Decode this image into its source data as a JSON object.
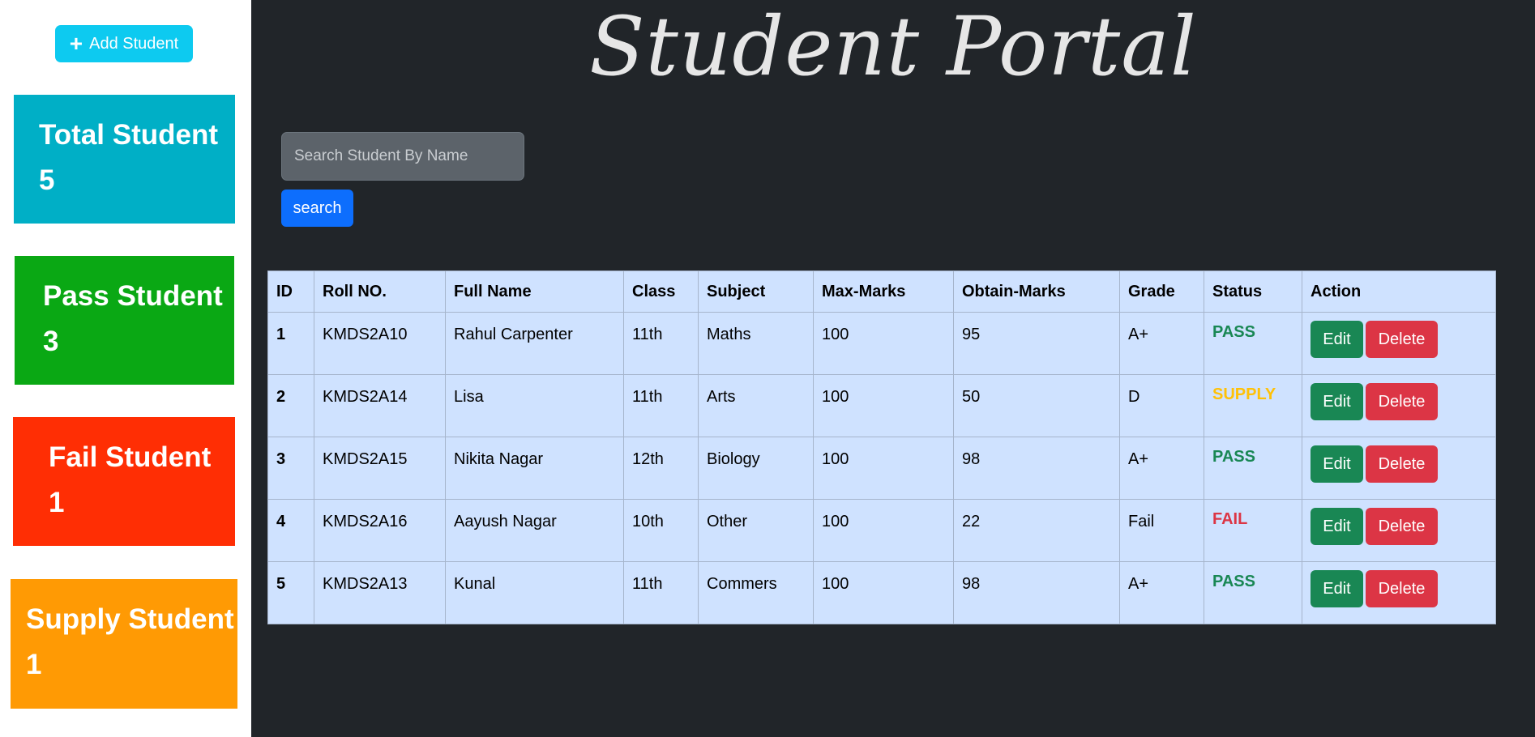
{
  "sidebar": {
    "add_button_label": "Add Student",
    "cards": {
      "total": {
        "label": "Total Student",
        "count": "5",
        "color": "#00afc6"
      },
      "pass": {
        "label": "Pass Student",
        "count": "3",
        "color": "#0aa814"
      },
      "fail": {
        "label": "Fail Student",
        "count": "1",
        "color": "#ff2e04"
      },
      "supply": {
        "label": "Supply Student",
        "count": "1",
        "color": "#ff9a04"
      }
    }
  },
  "main": {
    "title": "Student Portal",
    "search": {
      "placeholder": "Search Student By Name",
      "value": "",
      "button_label": "search"
    },
    "table": {
      "headers": [
        "ID",
        "Roll NO.",
        "Full Name",
        "Class",
        "Subject",
        "Max-Marks",
        "Obtain-Marks",
        "Grade",
        "Status",
        "Action"
      ],
      "edit_label": "Edit",
      "delete_label": "Delete",
      "rows": [
        {
          "id": "1",
          "roll": "KMDS2A10",
          "name": "Rahul Carpenter",
          "class": "11th",
          "subject": "Maths",
          "max": "100",
          "obtain": "95",
          "grade": "A+",
          "status": "PASS",
          "status_color": "#198754"
        },
        {
          "id": "2",
          "roll": "KMDS2A14",
          "name": "Lisa",
          "class": "11th",
          "subject": "Arts",
          "max": "100",
          "obtain": "50",
          "grade": "D",
          "status": "SUPPLY",
          "status_color": "#ffc107"
        },
        {
          "id": "3",
          "roll": "KMDS2A15",
          "name": "Nikita Nagar",
          "class": "12th",
          "subject": "Biology",
          "max": "100",
          "obtain": "98",
          "grade": "A+",
          "status": "PASS",
          "status_color": "#198754"
        },
        {
          "id": "4",
          "roll": "KMDS2A16",
          "name": "Aayush Nagar",
          "class": "10th",
          "subject": "Other",
          "max": "100",
          "obtain": "22",
          "grade": "Fail",
          "status": "FAIL",
          "status_color": "#dc3545"
        },
        {
          "id": "5",
          "roll": "KMDS2A13",
          "name": "Kunal",
          "class": "11th",
          "subject": "Commers",
          "max": "100",
          "obtain": "98",
          "grade": "A+",
          "status": "PASS",
          "status_color": "#198754"
        }
      ]
    }
  }
}
